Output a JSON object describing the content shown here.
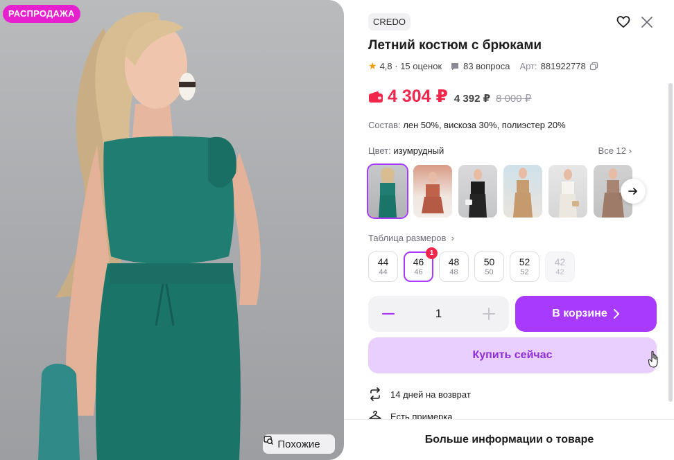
{
  "photo": {
    "sale_badge": "РАСПРОДАЖА",
    "similar_label": "Похожие"
  },
  "product": {
    "brand": "CREDO",
    "title": "Летний костюм с брюками",
    "rating": "4,8",
    "reviews": "15 оценок",
    "questions": "83 вопроса",
    "article_label": "Арт:",
    "article": "881922778",
    "price": "4 304 ₽",
    "price_wallet": "4 392 ₽",
    "price_old": "8 000 ₽",
    "composition_label": "Состав:",
    "composition": "лен 50%, вискоза 30%, полиэстер 20%",
    "color_label": "Цвет:",
    "color_value": "изумрудный",
    "all_colors": "Все 12",
    "size_table": "Таблица размеров"
  },
  "sizes": [
    {
      "ru": "44",
      "eu": "44",
      "state": "normal"
    },
    {
      "ru": "46",
      "eu": "46",
      "state": "active",
      "badge": "1"
    },
    {
      "ru": "48",
      "eu": "48",
      "state": "normal"
    },
    {
      "ru": "50",
      "eu": "50",
      "state": "normal"
    },
    {
      "ru": "52",
      "eu": "52",
      "state": "normal"
    },
    {
      "ru": "42",
      "eu": "42",
      "state": "disabled"
    }
  ],
  "cart": {
    "quantity": "1",
    "in_cart_label": "В корзине",
    "buy_now_label": "Купить сейчас"
  },
  "features": {
    "return": "14 дней на возврат",
    "fitting": "Есть примерка"
  },
  "bottom": {
    "more_info": "Больше информации о товаре"
  },
  "colors": {
    "accent": "#a73afd",
    "price": "#f0264c",
    "sale_badge": "#e61fcf",
    "buy_now_bg": "#e9cffd"
  },
  "thumbnails": [
    {
      "name": "emerald",
      "selected": true
    },
    {
      "name": "terracotta",
      "selected": false
    },
    {
      "name": "black",
      "selected": false
    },
    {
      "name": "beige",
      "selected": false
    },
    {
      "name": "white",
      "selected": false
    },
    {
      "name": "mocha",
      "selected": false
    }
  ]
}
